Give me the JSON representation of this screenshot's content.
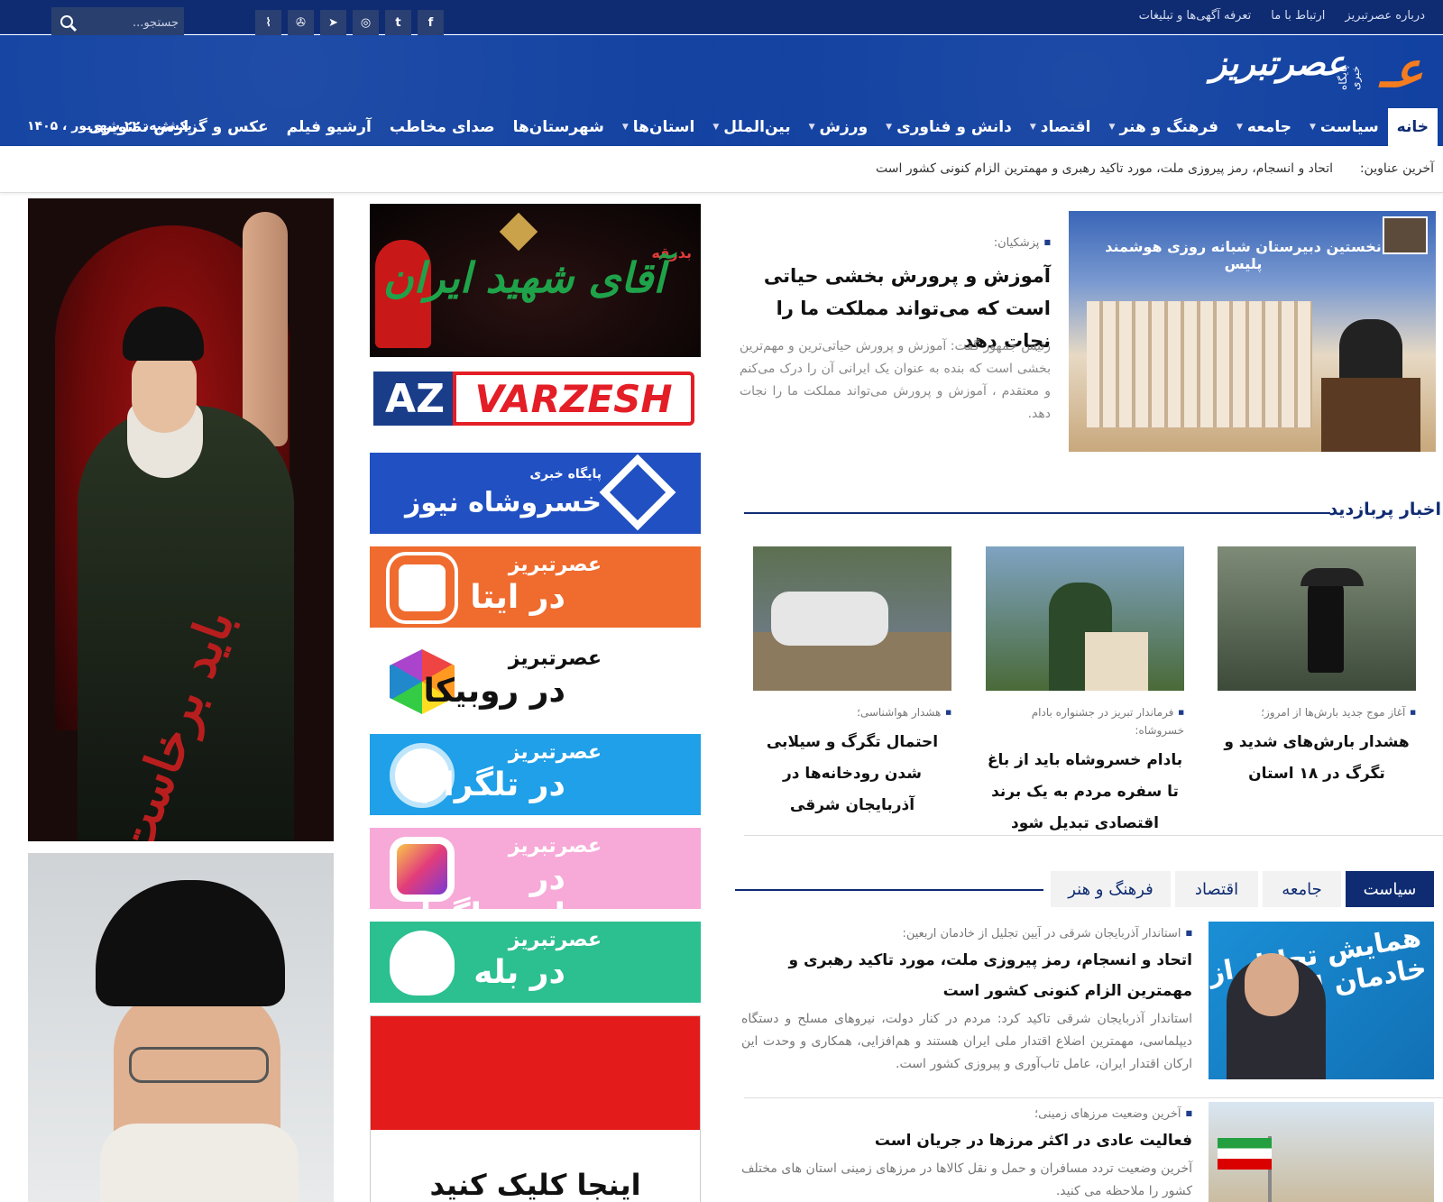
{
  "top_links": [
    "درباره عصرتبریز",
    "ارتباط با ما",
    "تعرفه آگهی‌ها و تبلیغات"
  ],
  "social_icons": [
    "facebook-icon",
    "twitter-icon",
    "instagram-icon",
    "telegram-icon",
    "aparat-icon",
    "rss-icon"
  ],
  "search": {
    "placeholder": "جستجو..."
  },
  "logo": {
    "mark": "عـ",
    "name": "عصرتبریز",
    "sub": "پایگاه خبری"
  },
  "nav": {
    "home": "خانه",
    "items": [
      {
        "label": "سیاست",
        "dropdown": true
      },
      {
        "label": "جامعه",
        "dropdown": true
      },
      {
        "label": "فرهنگ و هنر",
        "dropdown": true
      },
      {
        "label": "اقتصاد",
        "dropdown": true
      },
      {
        "label": "دانش و فناوری",
        "dropdown": true
      },
      {
        "label": "ورزش",
        "dropdown": true
      },
      {
        "label": "بین‌الملل",
        "dropdown": true
      },
      {
        "label": "استان‌ها",
        "dropdown": true
      },
      {
        "label": "شهرستان‌ها",
        "dropdown": false
      },
      {
        "label": "صدای مخاطب",
        "dropdown": false
      },
      {
        "label": "آرشیو فیلم",
        "dropdown": false
      },
      {
        "label": "عکس و گزارش تصویری",
        "dropdown": false
      }
    ],
    "date": "یکشنبه، ۲۲ شهریور ، ۱۴۰۵"
  },
  "ticker": {
    "label": "آخرین عناوین:",
    "text": "اتحاد و انسجام، رمز پیروزی ملت، مورد تاکید رهبری و مهمترین الزام کنونی کشور است"
  },
  "posters": {
    "calligraphy": "باید برخاست"
  },
  "ads": {
    "ad1": {
      "pre": "بدرقه",
      "title": "آقای شهید ایران"
    },
    "ad2": {
      "left": "AZ",
      "right": "VARZESH"
    },
    "ad3": {
      "small": "پایگاه خبری",
      "big": "خسروشاه نیوز"
    },
    "social": [
      {
        "small": "عصرتبریز",
        "big": "در ایتا"
      },
      {
        "small": "عصرتبریز",
        "big": "در روبیکا"
      },
      {
        "small": "عصرتبریز",
        "big": "در تلگرام"
      },
      {
        "small": "عصرتبریز",
        "big": "در اینستاگرام"
      },
      {
        "small": "عصرتبریز",
        "big": "در بله"
      }
    ],
    "ad9": {
      "text": "اینجا کلیک کنید"
    }
  },
  "lead": {
    "kicker": "پزشکیان:",
    "title": "آموزش و پرورش بخشی حیاتی است که می‌تواند مملکت ما را نجات دهد",
    "summary": "رئیس جمهور گفت: آموزش و پرورش حیاتی‌ترین و مهم‌ترین بخشی است که بنده به عنوان یک ایرانی آن را درک می‌کنم و معتقدم ، آموزش و پرورش می‌تواند مملکت ما را نجات دهد.",
    "image_caption": "نخستین دبیرستان شبانه روزی هوشمند پلیس"
  },
  "popular": {
    "title": "اخبار پربازدید",
    "cards": [
      {
        "kicker": "آغاز موج جدید بارش‌ها از امروز؛",
        "title": "هشدار بارش‌های شدید و تگرگ در ۱۸ استان"
      },
      {
        "kicker": "فرماندار تبریز در جشنواره بادام خسروشاه:",
        "title": "بادام خسروشاه باید از باغ تا سفره مردم به یک برند اقتصادی تبدیل شود"
      },
      {
        "kicker": "هشدار هواشناسی؛",
        "title": "احتمال تگرگ و سیلابی شدن رودخانه‌ها در آذربایجان شرقی"
      }
    ]
  },
  "tabs": [
    {
      "label": "سیاست",
      "active": true
    },
    {
      "label": "جامعه",
      "active": false
    },
    {
      "label": "اقتصاد",
      "active": false
    },
    {
      "label": "فرهنگ و هنر",
      "active": false
    }
  ],
  "stories": [
    {
      "kicker": "استاندار آذربایجان شرقی در آیین تجلیل از خادمان اربعین:",
      "title": "اتحاد و انسجام، رمز پیروزی ملت، مورد تاکید رهبری و مهمترین الزام کنونی کشور است",
      "summary": "استاندار آذربایجان شرقی تاکید کرد: مردم در کنار دولت، نیروهای مسلح و دستگاه دیپلماسی، مهمترین اضلاع اقتدار ملی ایران هستند و هم‌افزایی، همکاری و وحدت این ارکان اقتدار ایران، عامل تاب‌آوری و پیروزی کشور است.",
      "image_caption": "همایش تجلیل از خادمان اربعین"
    },
    {
      "kicker": "آخرین وضعیت مرزهای زمینی؛",
      "title": "فعالیت عادی در اکثر مرزها در جریان است",
      "summary": "آخرین وضعیت تردد مسافران و حمل و نقل کالاها در مرزهای زمینی استان های مختلف کشور را ملاحظه می کنید."
    }
  ]
}
